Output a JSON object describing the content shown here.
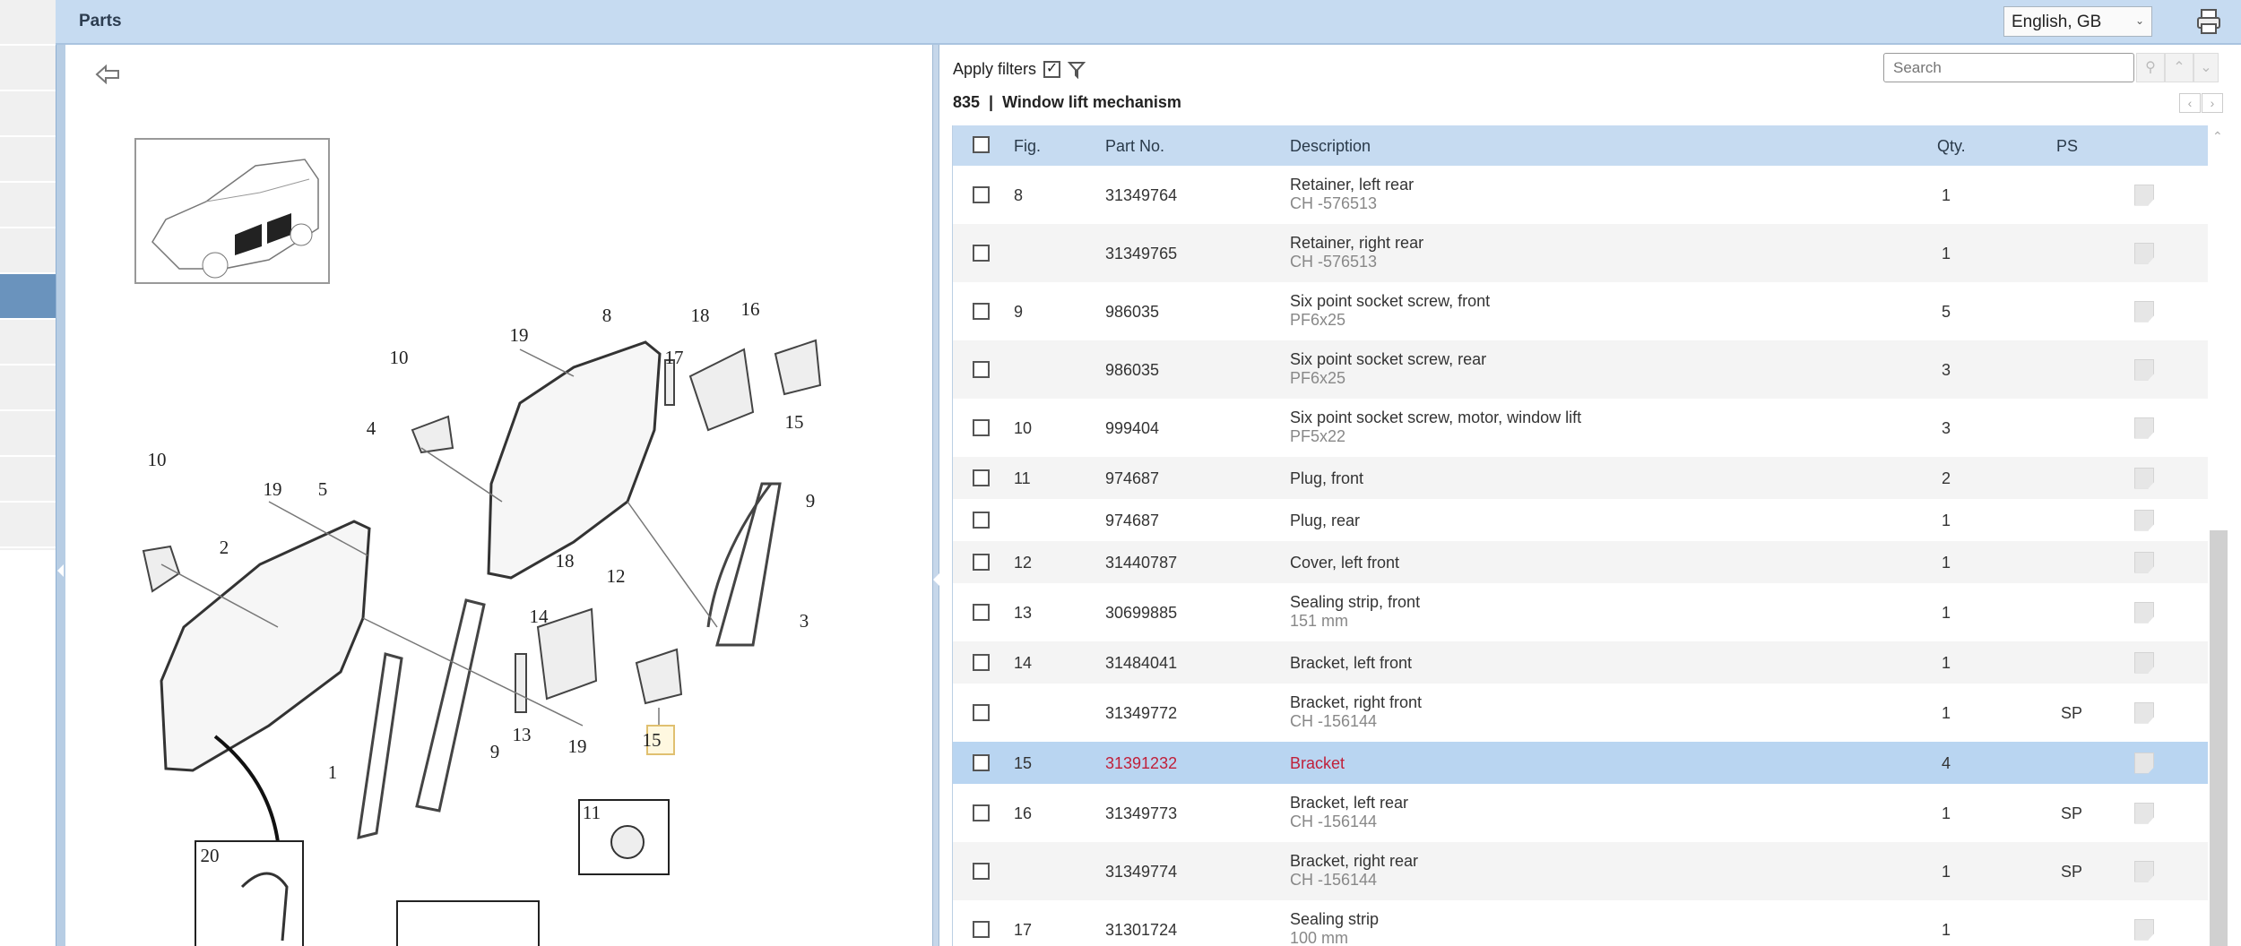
{
  "header": {
    "title": "Parts",
    "language": "English, GB"
  },
  "toolbar": {
    "apply_filters": "Apply filters",
    "apply_filters_checked": true,
    "search_placeholder": "Search"
  },
  "section": {
    "title": "835  |  Window lift mechanism"
  },
  "table": {
    "columns": {
      "fig": "Fig.",
      "part_no": "Part No.",
      "description": "Description",
      "qty": "Qty.",
      "ps": "PS"
    },
    "rows": [
      {
        "fig": "8",
        "part_no": "31349764",
        "desc": "Retainer, left rear",
        "sub": "CH -576513",
        "qty": "1",
        "ps": ""
      },
      {
        "fig": "",
        "part_no": "31349765",
        "desc": "Retainer, right rear",
        "sub": "CH -576513",
        "qty": "1",
        "ps": ""
      },
      {
        "fig": "9",
        "part_no": "986035",
        "desc": "Six point socket screw, front",
        "sub": "PF6x25",
        "qty": "5",
        "ps": ""
      },
      {
        "fig": "",
        "part_no": "986035",
        "desc": "Six point socket screw, rear",
        "sub": "PF6x25",
        "qty": "3",
        "ps": ""
      },
      {
        "fig": "10",
        "part_no": "999404",
        "desc": "Six point socket screw, motor, window lift",
        "sub": "PF5x22",
        "qty": "3",
        "ps": ""
      },
      {
        "fig": "11",
        "part_no": "974687",
        "desc": "Plug, front",
        "sub": "",
        "qty": "2",
        "ps": ""
      },
      {
        "fig": "",
        "part_no": "974687",
        "desc": "Plug, rear",
        "sub": "",
        "qty": "1",
        "ps": ""
      },
      {
        "fig": "12",
        "part_no": "31440787",
        "desc": "Cover, left front",
        "sub": "",
        "qty": "1",
        "ps": ""
      },
      {
        "fig": "13",
        "part_no": "30699885",
        "desc": "Sealing strip, front",
        "sub": "151 mm",
        "qty": "1",
        "ps": ""
      },
      {
        "fig": "14",
        "part_no": "31484041",
        "desc": "Bracket, left front",
        "sub": "",
        "qty": "1",
        "ps": ""
      },
      {
        "fig": "",
        "part_no": "31349772",
        "desc": "Bracket, right front",
        "sub": "CH -156144",
        "qty": "1",
        "ps": "SP"
      },
      {
        "fig": "15",
        "part_no": "31391232",
        "desc": "Bracket",
        "sub": "",
        "qty": "4",
        "ps": "",
        "selected": true
      },
      {
        "fig": "16",
        "part_no": "31349773",
        "desc": "Bracket, left rear",
        "sub": "CH -156144",
        "qty": "1",
        "ps": "SP"
      },
      {
        "fig": "",
        "part_no": "31349774",
        "desc": "Bracket, right rear",
        "sub": "CH -156144",
        "qty": "1",
        "ps": "SP"
      },
      {
        "fig": "17",
        "part_no": "31301724",
        "desc": "Sealing strip",
        "sub": "100 mm",
        "qty": "1",
        "ps": ""
      }
    ]
  },
  "diagram": {
    "callouts": [
      "10",
      "19",
      "8",
      "18",
      "16",
      "17",
      "4",
      "15",
      "10",
      "19",
      "5",
      "2",
      "9",
      "18",
      "12",
      "14",
      "3",
      "13",
      "19",
      "15",
      "1",
      "9",
      "11",
      "20"
    ]
  },
  "colors": {
    "header": "#c6dbf1",
    "selected_row": "#b9d5f1",
    "selected_text": "#c0203a"
  }
}
